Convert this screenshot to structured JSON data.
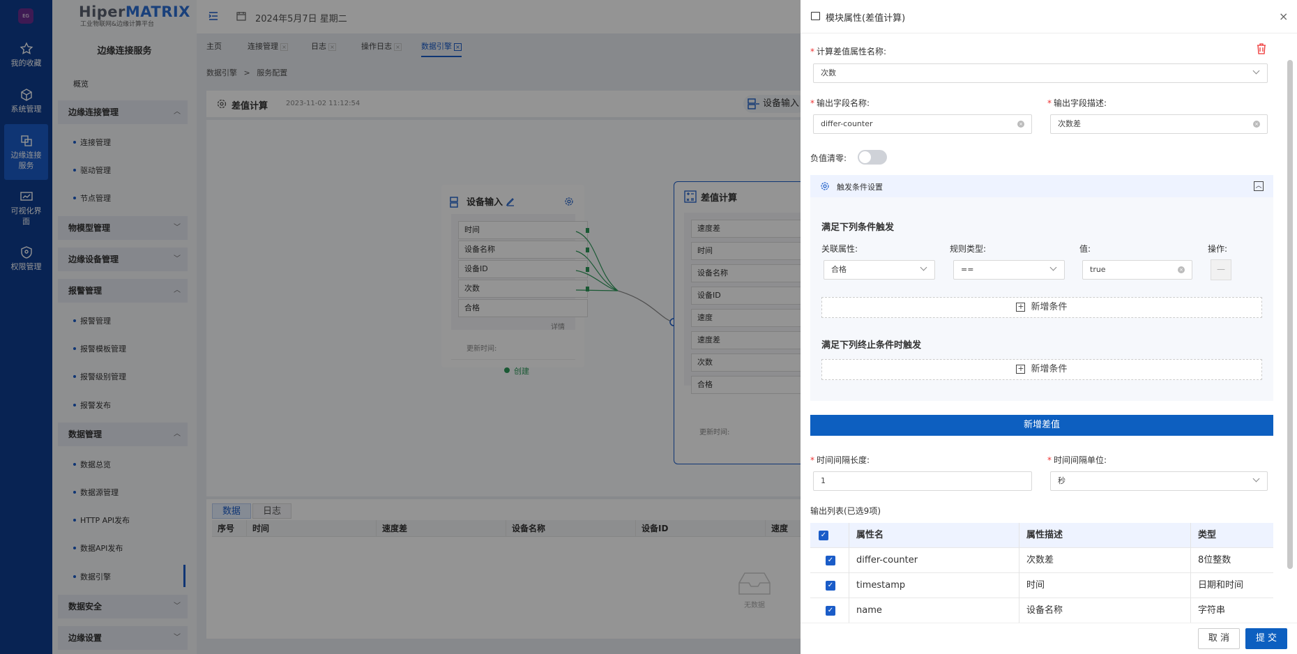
{
  "rail": {
    "logo": "EG",
    "items": [
      "我的收藏",
      "系统管理",
      "边缘连接服务",
      "可视化界面",
      "权限管理"
    ]
  },
  "brand": {
    "name_a": "Hiper",
    "name_b": "MATRIX",
    "sub": "工业物联网&边缘计算平台"
  },
  "side": {
    "title": "边缘连接服务",
    "overview": "概览",
    "groups": [
      "边缘连接管理",
      "物模型管理",
      "边缘设备管理",
      "报警管理",
      "数据管理",
      "数据安全",
      "边缘设置"
    ],
    "sub_conn": [
      "连接管理",
      "驱动管理",
      "节点管理"
    ],
    "sub_alarm": [
      "报警管理",
      "报警模板管理",
      "报警级别管理",
      "报警发布"
    ],
    "sub_data": [
      "数据总览",
      "数据源管理",
      "HTTP API发布",
      "数据API发布",
      "数据引擎"
    ]
  },
  "topbar": {
    "date": "2024年5月7日 星期二"
  },
  "tabs": [
    "主页",
    "连接管理",
    "日志",
    "操作日志",
    "数据引擎"
  ],
  "crumb": {
    "a": "数据引擎",
    "sep": ">",
    "b": "服务配置"
  },
  "panel": {
    "title": "差值计算",
    "time": "2023-11-02 11:12:54",
    "device_btn": "设备输入"
  },
  "node1": {
    "title": "设备输入",
    "rows": [
      "时间",
      "设备名称",
      "设备ID",
      "次数",
      "合格"
    ],
    "detail": "详情",
    "update": "更新时间:",
    "create": "创建"
  },
  "node2": {
    "title": "差值计算",
    "rows": [
      "速度差",
      "时间",
      "设备名称",
      "设备ID",
      "速度",
      "速度差",
      "次数",
      "合格"
    ],
    "update": "更新时间:"
  },
  "bottom": {
    "tabs": [
      "数据",
      "日志"
    ],
    "cols": [
      "序号",
      "时间",
      "速度差",
      "设备名称",
      "设备ID",
      "速度"
    ],
    "empty": "无数据"
  },
  "drawer": {
    "title": "模块属性(差值计算)",
    "calc_label": "计算差值属性名称:",
    "calc_value": "次数",
    "out_name_label": "输出字段名称:",
    "out_name_value": "differ-counter",
    "out_desc_label": "输出字段描述:",
    "out_desc_value": "次数差",
    "neg_label": "负值清零:",
    "trigger_title": "触发条件设置",
    "cond1": "满足下列条件触发",
    "col_attr": "关联属性:",
    "col_rule": "规则类型:",
    "col_val": "值:",
    "col_op": "操作:",
    "attr_val": "合格",
    "rule_val": "==",
    "val_val": "true",
    "op_val": "—",
    "add_cond": "新增条件",
    "cond2": "满足下列终止条件时触发",
    "add_diff": "新增差值",
    "interval_label": "时间间隔长度:",
    "interval_value": "1",
    "unit_label": "时间间隔单位:",
    "unit_value": "秒",
    "list_title": "输出列表(已选9项)",
    "table_head": [
      "属性名",
      "属性描述",
      "类型"
    ],
    "rows": [
      [
        "differ-counter",
        "次数差",
        "8位整数"
      ],
      [
        "timestamp",
        "时间",
        "日期和时间"
      ],
      [
        "name",
        "设备名称",
        "字符串"
      ]
    ],
    "cancel": "取 消",
    "submit": "提 交"
  },
  "colors": {
    "primary": "#1a5cc8",
    "rail": "#0f3d8f"
  }
}
